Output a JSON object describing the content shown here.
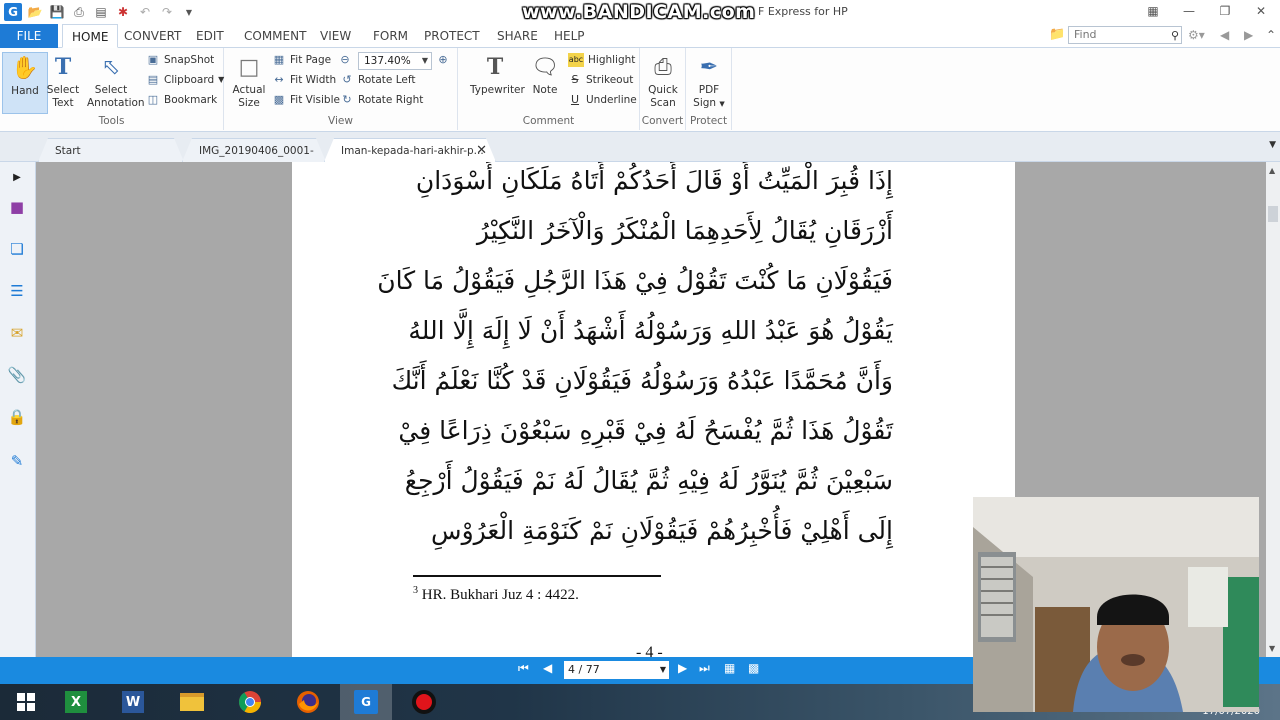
{
  "titlebar": {
    "title": "F Express for HP",
    "watermark": "www.BANDICAM.com"
  },
  "menu": {
    "file": "FILE",
    "tabs": [
      "HOME",
      "CONVERT",
      "EDIT",
      "COMMENT",
      "VIEW",
      "FORM",
      "PROTECT",
      "SHARE",
      "HELP"
    ],
    "active": "HOME",
    "find_placeholder": "Find"
  },
  "ribbon": {
    "tools": {
      "label": "Tools",
      "hand": "Hand",
      "select_text": [
        "Select",
        "Text"
      ],
      "select_annotation": [
        "Select",
        "Annotation"
      ],
      "snapshot": "SnapShot",
      "clipboard": "Clipboard",
      "bookmark": "Bookmark"
    },
    "view": {
      "label": "View",
      "actual_size": [
        "Actual",
        "Size"
      ],
      "fit_page": "Fit Page",
      "fit_width": "Fit Width",
      "fit_visible": "Fit Visible",
      "zoom": "137.40%",
      "rotate_left": "Rotate Left",
      "rotate_right": "Rotate Right"
    },
    "comment": {
      "label": "Comment",
      "typewriter": "Typewriter",
      "note": "Note",
      "highlight": "Highlight",
      "strikeout": "Strikeout",
      "underline": "Underline"
    },
    "convert": {
      "label": "Convert",
      "quick_scan": [
        "Quick",
        "Scan"
      ]
    },
    "protect": {
      "label": "Protect",
      "pdf_sign": [
        "PDF",
        "Sign"
      ]
    }
  },
  "doc_tabs": [
    "Start",
    "IMG_20190406_0001-m...",
    "Iman-kepada-hari-akhir-p..."
  ],
  "document": {
    "arabic_lines": [
      "إِذَا قُبِرَ الْمَيِّتُ أَوْ قَالَ أَحَدُكُمْ أَتَاهُ مَلَكَانِ أَسْوَدَانِ",
      "أَزْرَقَانِ يُقَالُ لِأَحَدِهِمَا الْمُنْكَرُ وَالْآخَرُ النَّكِيْرُ",
      "فَيَقُوْلَانِ مَا كُنْتَ تَقُوْلُ فِيْ هَذَا الرَّجُلِ فَيَقُوْلُ مَا كَانَ",
      "يَقُوْلُ هُوَ عَبْدُ اللهِ وَرَسُوْلُهُ أَشْهَدُ أَنْ لَا إِلَهَ إِلَّا اللهُ",
      "وَأَنَّ مُحَمَّدًا عَبْدُهُ وَرَسُوْلُهُ فَيَقُوْلَانِ قَدْ كُنَّا نَعْلَمُ أَنَّكَ",
      "تَقُوْلُ هَذَا ثُمَّ يُفْسَحُ لَهُ فِيْ قَبْرِهِ سَبْعُوْنَ ذِرَاعًا فِيْ",
      "سَبْعِيْنَ ثُمَّ يُنَوَّرُ لَهُ فِيْهِ ثُمَّ يُقَالُ لَهُ نَمْ فَيَقُوْلُ أَرْجِعُ",
      "إِلَى أَهْلِيْ فَأُخْبِرُهُمْ فَيَقُوْلَانِ نَمْ كَنَوْمَةِ الْعَرُوْسِ"
    ],
    "footnote_num": "3",
    "footnote_text": " HR. Bukhari Juz 4 : 4422.",
    "page_number": "- 4 -"
  },
  "statusbar": {
    "page": "4 / 77"
  },
  "taskbar": {
    "date": "17/07/2020"
  },
  "colors": {
    "accent": "#1e7bd6",
    "statusbar": "#1a8ae0"
  }
}
